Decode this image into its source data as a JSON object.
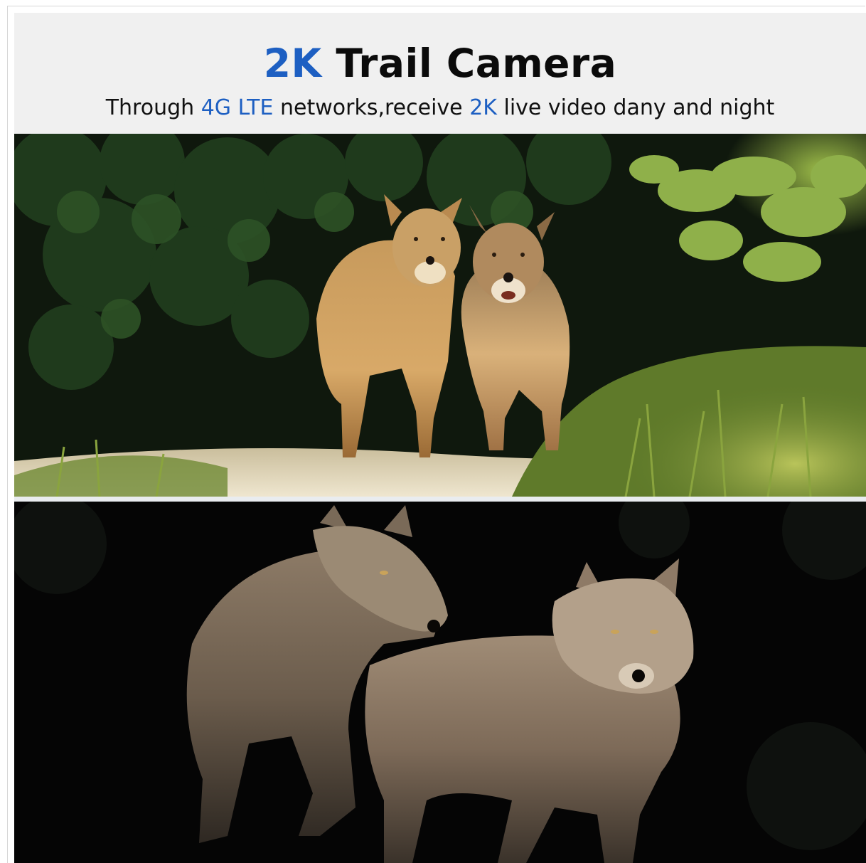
{
  "header": {
    "title_accent": "2K",
    "title_rest": "Trail Camera",
    "subtitle_part1": "Through",
    "subtitle_accent1": "4G LTE",
    "subtitle_part2": "networks,receive",
    "subtitle_accent2": "2K",
    "subtitle_part3": "live video dany and night"
  },
  "colors": {
    "accent": "#1d5fc2",
    "header_background": "#f0f0f0",
    "text": "#0b0b0b"
  },
  "photos": [
    {
      "scene": "daytime photo of two wolves standing on a sandy path in front of dark forest foliage"
    },
    {
      "scene": "night photo of two wolves in a dark forest"
    }
  ]
}
